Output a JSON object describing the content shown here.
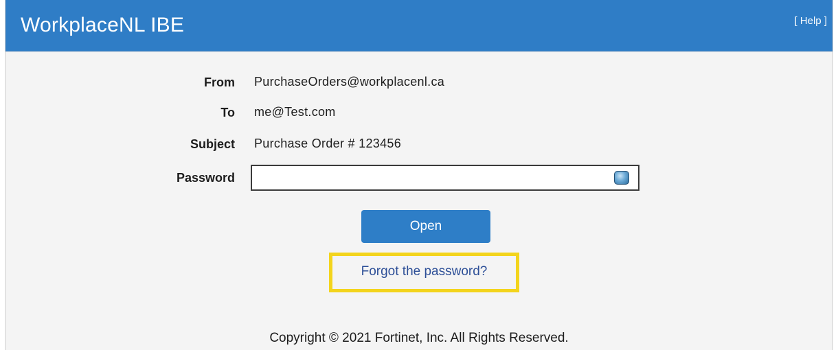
{
  "header": {
    "title": "WorkplaceNL IBE",
    "help_label": "[ Help ]",
    "background_color": "#2f7dc6"
  },
  "form": {
    "from_label": "From",
    "from_value": "PurchaseOrders@workplacenl.ca",
    "to_label": "To",
    "to_value": "me@Test.com",
    "subject_label": "Subject",
    "subject_value": "Purchase Order # 123456",
    "password_label": "Password",
    "password_value": "",
    "keyboard_icon": "virtual-keyboard-icon"
  },
  "actions": {
    "open_label": "Open",
    "forgot_label": "Forgot the password?",
    "highlight_color": "#f3d41c"
  },
  "footer": {
    "copyright": "Copyright © 2021 Fortinet, Inc. All Rights Reserved."
  }
}
